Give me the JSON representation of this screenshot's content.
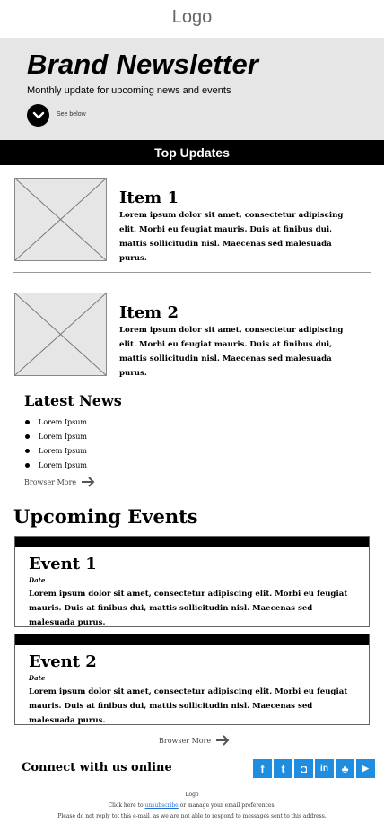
{
  "header": {
    "logo": "Logo"
  },
  "hero": {
    "title": "Brand Newsletter",
    "subtitle": "Monthly update for upcoming news and events",
    "button_label": "See below"
  },
  "top_updates": {
    "heading": "Top Updates",
    "items": [
      {
        "title": "Item 1",
        "text": "Lorem ipsum dolor sit amet, consectetur adipiscing elit. Morbi eu feugiat mauris. Duis at finibus dui, mattis sollicitudin nisl. Maecenas sed malesuada purus."
      },
      {
        "title": "Item 2",
        "text": "Lorem ipsum dolor sit amet, consectetur adipiscing elit. Morbi eu feugiat mauris. Duis at finibus dui, mattis sollicitudin nisl. Maecenas sed malesuada purus."
      }
    ]
  },
  "latest_news": {
    "heading": "Latest News",
    "items": [
      "Lorem Ipsum",
      "Lorem Ipsum",
      "Lorem Ipsum",
      "Lorem Ipsum"
    ],
    "browse_label": "Browser More"
  },
  "events": {
    "heading": "Upcoming Events",
    "items": [
      {
        "title": "Event 1",
        "date": "Date",
        "text": "Lorem ipsum dolor sit amet, consectetur adipiscing elit. Morbi eu feugiat mauris. Duis at finibus dui, mattis sollicitudin nisl. Maecenas sed malesuada purus."
      },
      {
        "title": "Event 2",
        "date": "Date",
        "text": "Lorem ipsum dolor sit amet, consectetur adipiscing elit. Morbi eu feugiat mauris. Duis at finibus dui, mattis sollicitudin nisl. Maecenas sed malesuada purus."
      }
    ],
    "browse_label": "Browser More"
  },
  "connect": {
    "heading": "Connect with us online",
    "socials": [
      {
        "name": "facebook-icon",
        "glyph": "f"
      },
      {
        "name": "tumblr-icon",
        "glyph": "t"
      },
      {
        "name": "instagram-icon",
        "glyph": "◘"
      },
      {
        "name": "linkedin-icon",
        "glyph": "in"
      },
      {
        "name": "snapchat-icon",
        "glyph": "♣"
      },
      {
        "name": "youtube-icon",
        "glyph": "▶"
      }
    ],
    "color": "#1f8ee0"
  },
  "footer": {
    "logo": "Logo",
    "click_prefix": "Click here to",
    "unsubscribe": "unsubscribe",
    "click_suffix": "or manage your email preferences.",
    "note": "Please do not reply tot this e-mail, as we are not able to respond to messages sent to this address."
  }
}
